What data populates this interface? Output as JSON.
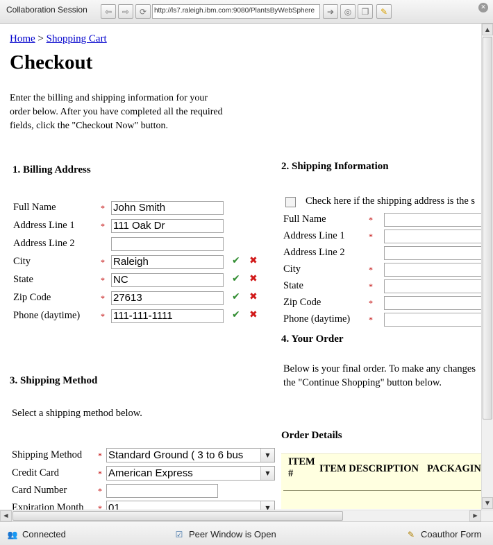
{
  "window": {
    "title": "Collaboration Session",
    "url": "http://ls7.raleigh.ibm.com:9080/PlantsByWebSphere",
    "icons": [
      "back-arrow-icon",
      "forward-arrow-icon",
      "refresh-icon",
      "go-icon",
      "share-icon",
      "copy-icon",
      "highlight-icon",
      "close-icon"
    ]
  },
  "breadcrumb": {
    "home": "Home",
    "separator": ">",
    "cart": "Shopping Cart"
  },
  "page_title": "Checkout",
  "intro": "Enter the billing and shipping information for your order below. After you have completed all the required fields, click the \"Checkout Now\" button.",
  "billing": {
    "heading": "1. Billing Address",
    "fields": [
      {
        "label": "Full Name",
        "required": "*",
        "value": "John Smith",
        "validated": false
      },
      {
        "label": "Address Line 1",
        "required": "*",
        "value": "111 Oak Dr",
        "validated": false
      },
      {
        "label": "Address Line 2",
        "required": "",
        "value": "",
        "validated": false
      },
      {
        "label": "City",
        "required": "*",
        "value": "Raleigh",
        "validated": true
      },
      {
        "label": "State",
        "required": "*",
        "value": "NC",
        "validated": true
      },
      {
        "label": "Zip Code",
        "required": "*",
        "value": "27613",
        "validated": true
      },
      {
        "label": "Phone (daytime)",
        "required": "*",
        "value": "111-111-1111",
        "validated": true
      }
    ],
    "check_mark": "✔",
    "cross_mark": "✖"
  },
  "shipping_info": {
    "heading": "2. Shipping Information",
    "same_as_billing": "Check here if the shipping address is the s",
    "fields": [
      {
        "label": "Full Name",
        "required": "*"
      },
      {
        "label": "Address Line 1",
        "required": "*"
      },
      {
        "label": "Address Line 2",
        "required": ""
      },
      {
        "label": "City",
        "required": "*"
      },
      {
        "label": "State",
        "required": "*"
      },
      {
        "label": "Zip Code",
        "required": "*"
      },
      {
        "label": "Phone (daytime)",
        "required": "*"
      }
    ]
  },
  "shipping_method": {
    "heading": "3. Shipping Method",
    "instruction": "Select a shipping method below.",
    "fields": [
      {
        "label": "Shipping Method",
        "required": "*",
        "value": "Standard Ground ( 3 to 6 bus"
      },
      {
        "label": "Credit Card",
        "required": "*",
        "value": "American Express"
      },
      {
        "label": "Card Number",
        "required": "*",
        "value": ""
      },
      {
        "label": "Expiration Month",
        "required": "*",
        "value": "01"
      }
    ]
  },
  "order": {
    "heading": "4. Your Order",
    "text_line1": "Below is your final order. To make any changes",
    "text_line2": "the \"Continue Shopping\" button below.",
    "details_heading": "Order Details",
    "columns": {
      "item": "ITEM",
      "item_hash": "#",
      "description": "ITEM DESCRIPTION",
      "packaging": "PACKAGIN"
    }
  },
  "status": {
    "connected": "Connected",
    "peer": "Peer Window is Open",
    "coauthor": "Coauthor Form"
  }
}
